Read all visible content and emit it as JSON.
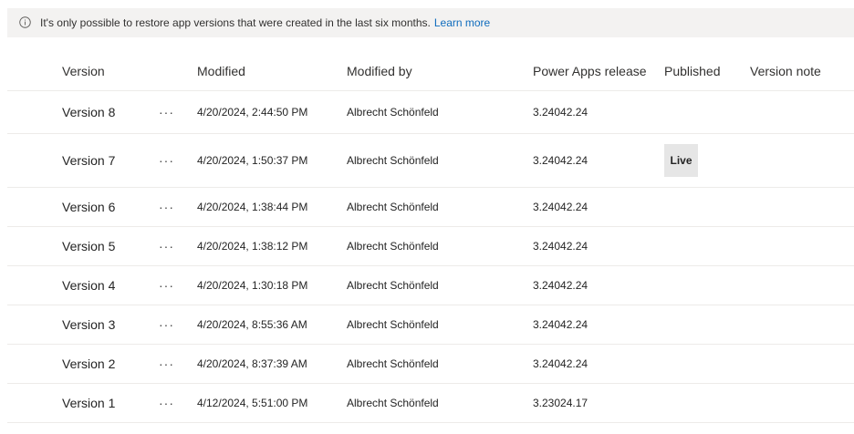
{
  "banner": {
    "icon": "info-icon",
    "text": "It's only possible to restore app versions that were created in the last six months.",
    "link": "Learn more"
  },
  "table": {
    "columns": {
      "version": "Version",
      "modified": "Modified",
      "modified_by": "Modified by",
      "release": "Power Apps release",
      "published": "Published",
      "note": "Version note"
    },
    "more_glyph": "···",
    "rows": [
      {
        "version": "Version 8",
        "modified": "4/20/2024, 2:44:50 PM",
        "modified_by": "Albrecht Schönfeld",
        "release": "3.24042.24",
        "published": ""
      },
      {
        "version": "Version 7",
        "modified": "4/20/2024, 1:50:37 PM",
        "modified_by": "Albrecht Schönfeld",
        "release": "3.24042.24",
        "published": "Live"
      },
      {
        "version": "Version 6",
        "modified": "4/20/2024, 1:38:44 PM",
        "modified_by": "Albrecht Schönfeld",
        "release": "3.24042.24",
        "published": ""
      },
      {
        "version": "Version 5",
        "modified": "4/20/2024, 1:38:12 PM",
        "modified_by": "Albrecht Schönfeld",
        "release": "3.24042.24",
        "published": ""
      },
      {
        "version": "Version 4",
        "modified": "4/20/2024, 1:30:18 PM",
        "modified_by": "Albrecht Schönfeld",
        "release": "3.24042.24",
        "published": ""
      },
      {
        "version": "Version 3",
        "modified": "4/20/2024, 8:55:36 AM",
        "modified_by": "Albrecht Schönfeld",
        "release": "3.24042.24",
        "published": ""
      },
      {
        "version": "Version 2",
        "modified": "4/20/2024, 8:37:39 AM",
        "modified_by": "Albrecht Schönfeld",
        "release": "3.24042.24",
        "published": ""
      },
      {
        "version": "Version 1",
        "modified": "4/12/2024, 5:51:00 PM",
        "modified_by": "Albrecht Schönfeld",
        "release": "3.23024.17",
        "published": ""
      }
    ]
  }
}
